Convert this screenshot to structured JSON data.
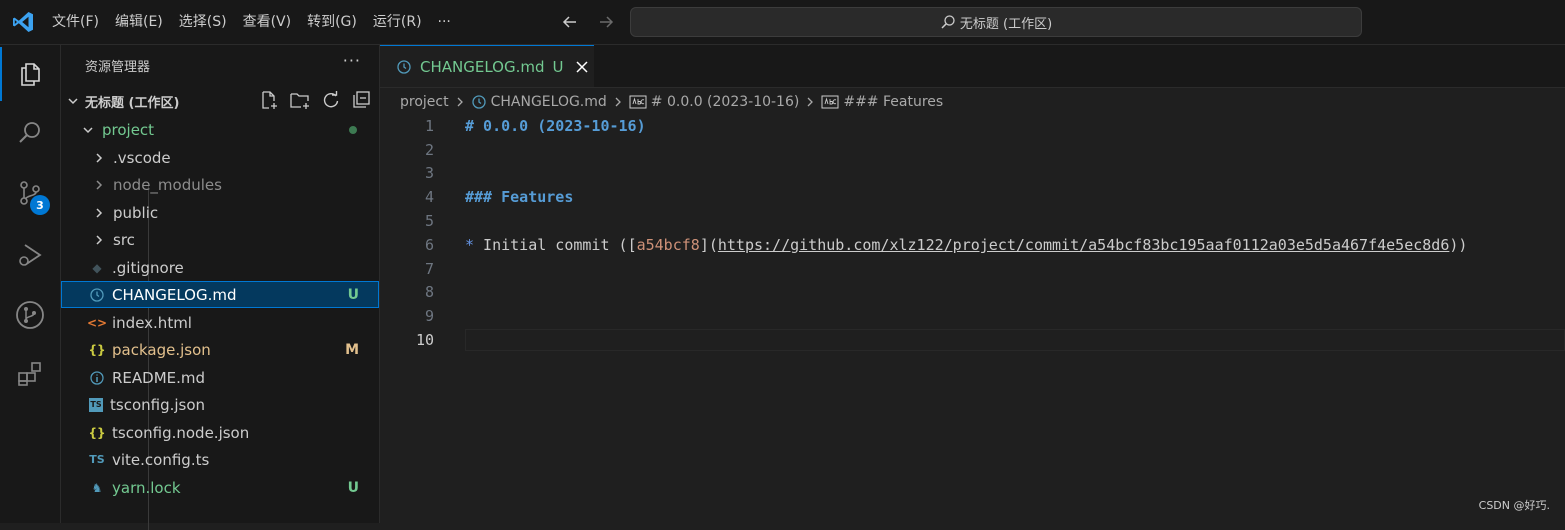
{
  "titlebar": {
    "menu": [
      "文件(F)",
      "编辑(E)",
      "选择(S)",
      "查看(V)",
      "转到(G)",
      "运行(R)",
      "···"
    ],
    "command_center": "无标题 (工作区)"
  },
  "activity": {
    "scm_badge": "3"
  },
  "explorer": {
    "title": "资源管理器",
    "more": "···",
    "workspace": "无标题 (工作区)",
    "folder": "project",
    "items": [
      {
        "label": ".vscode",
        "status": ""
      },
      {
        "label": "node_modules",
        "status": ""
      },
      {
        "label": "public",
        "status": ""
      },
      {
        "label": "src",
        "status": ""
      },
      {
        "label": ".gitignore",
        "status": ""
      },
      {
        "label": "CHANGELOG.md",
        "status": "U"
      },
      {
        "label": "index.html",
        "status": ""
      },
      {
        "label": "package.json",
        "status": "M"
      },
      {
        "label": "README.md",
        "status": ""
      },
      {
        "label": "tsconfig.json",
        "status": ""
      },
      {
        "label": "tsconfig.node.json",
        "status": ""
      },
      {
        "label": "vite.config.ts",
        "status": ""
      },
      {
        "label": "yarn.lock",
        "status": "U"
      }
    ]
  },
  "tab": {
    "label": "CHANGELOG.md",
    "status": "U"
  },
  "breadcrumb": [
    "project",
    "CHANGELOG.md",
    "# 0.0.0 (2023-10-16)",
    "### Features"
  ],
  "editor": {
    "line_numbers": [
      "1",
      "2",
      "3",
      "4",
      "5",
      "6",
      "7",
      "8",
      "9",
      "10"
    ],
    "lines": {
      "l1": "# 0.0.0 (2023-10-16)",
      "l4": "### Features",
      "l6_bullet": "*",
      "l6_text": " Initial commit (",
      "l6_open": "[",
      "l6_hash": "a54bcf8",
      "l6_close": "](",
      "l6_url": "https://github.com/xlz122/project/commit/a54bcf83bc195aaf0112a03e5d5a467f4e5ec8d6",
      "l6_end": "))"
    }
  },
  "watermark": "CSDN @好巧."
}
